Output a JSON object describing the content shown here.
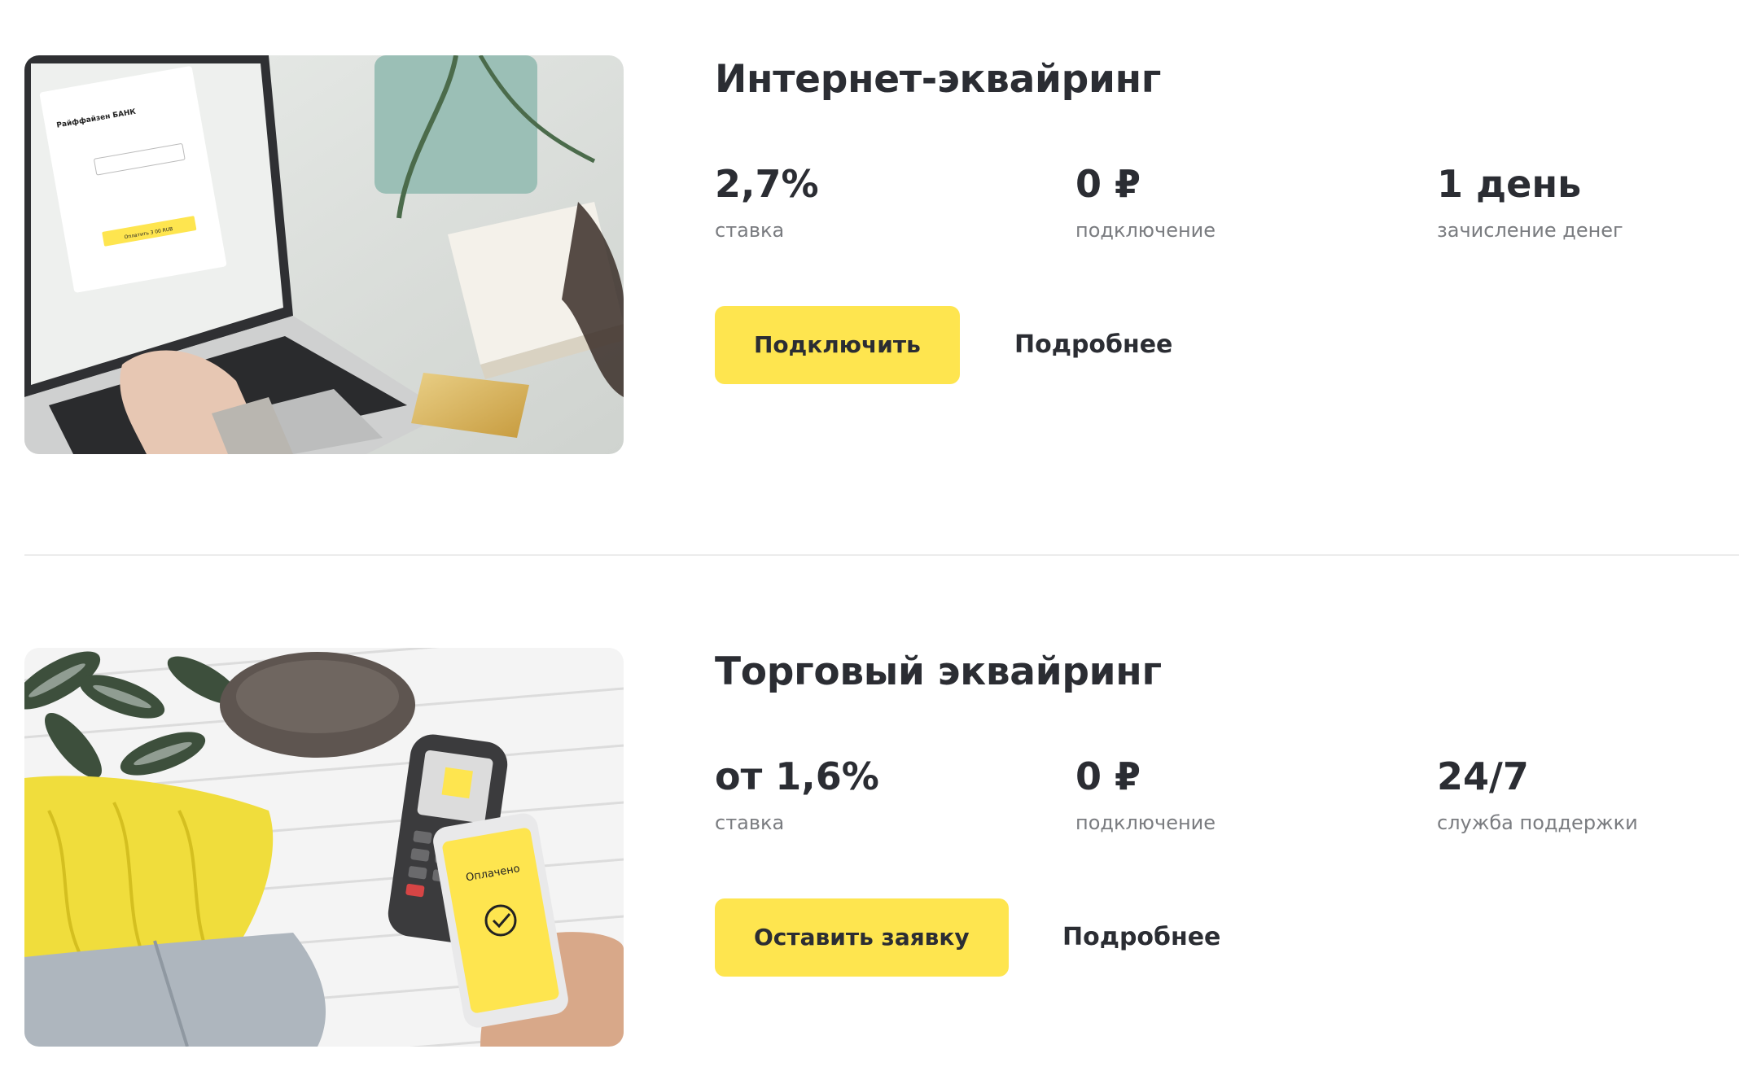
{
  "products": [
    {
      "title": "Интернет-эквайринг",
      "stats": [
        {
          "value": "2,7%",
          "label": "ставка"
        },
        {
          "value": "0 ₽",
          "label": "подключение"
        },
        {
          "value": "1 день",
          "label": "зачисление денег"
        }
      ],
      "primary_button": "Подключить",
      "details_link": "Подробнее",
      "image_text": {
        "bank_logo": "Райффайзен БАНК",
        "pay_button": "Оплатить 3 00 RUB"
      }
    },
    {
      "title": "Торговый эквайринг",
      "stats": [
        {
          "value": "от 1,6%",
          "label": "ставка"
        },
        {
          "value": "0 ₽",
          "label": "подключение"
        },
        {
          "value": "24/7",
          "label": "служба поддержки"
        }
      ],
      "primary_button": "Оставить заявку",
      "details_link": "Подробнее",
      "image_text": {
        "phone_status": "Оплачено"
      }
    }
  ],
  "colors": {
    "accent": "#fee54f",
    "text": "#2b2d33",
    "muted": "#7a7c80",
    "divider": "#ececec"
  }
}
